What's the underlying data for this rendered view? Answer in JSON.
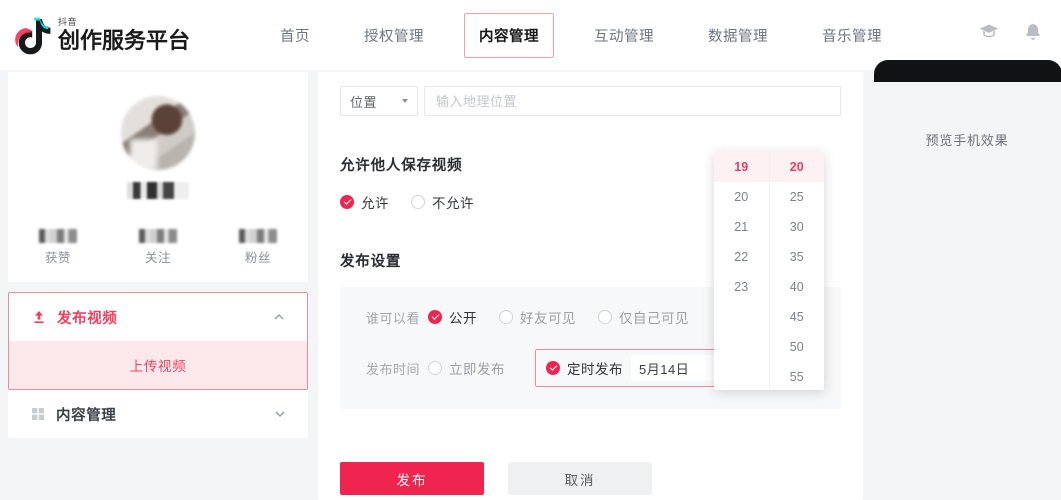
{
  "header": {
    "brand_sub": "抖音",
    "brand_title": "创作服务平台",
    "nav": [
      {
        "label": "首页",
        "active": false
      },
      {
        "label": "授权管理",
        "active": false
      },
      {
        "label": "内容管理",
        "active": true
      },
      {
        "label": "互动管理",
        "active": false
      },
      {
        "label": "数据管理",
        "active": false
      },
      {
        "label": "音乐管理",
        "active": false
      }
    ],
    "icons": [
      {
        "name": "graduation-cap-icon"
      },
      {
        "name": "bell-icon"
      }
    ]
  },
  "sidebar": {
    "profile": {
      "avatar": "user-avatar",
      "username": "",
      "stats": [
        {
          "value": "",
          "label": "获赞"
        },
        {
          "value": "",
          "label": "关注"
        },
        {
          "value": "",
          "label": "粉丝"
        }
      ]
    },
    "menu": [
      {
        "label": "发布视频",
        "icon": "upload-icon",
        "expanded": true,
        "chevron": "chevron-up-icon",
        "highlighted": true,
        "children": [
          {
            "label": "上传视频",
            "active": true
          }
        ]
      },
      {
        "label": "内容管理",
        "icon": "grid-icon",
        "expanded": false,
        "chevron": "chevron-down-icon",
        "highlighted": false,
        "children": []
      }
    ]
  },
  "main": {
    "location": {
      "select_label": "位置",
      "input_value": "",
      "input_placeholder": "输入地理位置"
    },
    "save_video": {
      "title": "允许他人保存视频",
      "options": [
        {
          "label": "允许",
          "selected": true
        },
        {
          "label": "不允许",
          "selected": false
        }
      ]
    },
    "publish_settings": {
      "title": "发布设置",
      "visibility": {
        "label": "谁可以看",
        "options": [
          {
            "label": "公开",
            "selected": true
          },
          {
            "label": "好友可见",
            "selected": false
          },
          {
            "label": "仅自己可见",
            "selected": false
          }
        ]
      },
      "publish_time": {
        "label": "发布时间",
        "options": [
          {
            "label": "立即发布",
            "selected": false
          },
          {
            "label": "定时发布",
            "selected": true
          }
        ],
        "date_value": "5月14日",
        "calendar_icon": "calendar-icon"
      }
    },
    "time_picker": {
      "hours": [
        {
          "value": "19",
          "selected": true
        },
        {
          "value": "20",
          "selected": false
        },
        {
          "value": "21",
          "selected": false
        },
        {
          "value": "22",
          "selected": false
        },
        {
          "value": "23",
          "selected": false
        }
      ],
      "minutes": [
        {
          "value": "20",
          "selected": true
        },
        {
          "value": "25",
          "selected": false
        },
        {
          "value": "30",
          "selected": false
        },
        {
          "value": "35",
          "selected": false
        },
        {
          "value": "40",
          "selected": false
        },
        {
          "value": "45",
          "selected": false
        },
        {
          "value": "50",
          "selected": false
        },
        {
          "value": "55",
          "selected": false
        }
      ]
    },
    "actions": {
      "publish_label": "发布",
      "cancel_label": "取消"
    }
  },
  "preview": {
    "label": "预览手机效果"
  },
  "colors": {
    "accent_red": "#f0254f",
    "accent_pink_border": "#f08a9b",
    "submenu_bg": "#fde9ec",
    "time_sel": "#ea3d63",
    "panel_bg": "#f7f8fa"
  }
}
